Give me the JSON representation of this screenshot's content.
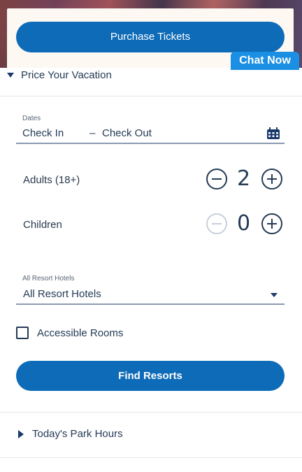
{
  "hero": {
    "purchase_label": "Purchase Tickets"
  },
  "chat": {
    "label": "Chat Now"
  },
  "price_section": {
    "title": "Price Your Vacation"
  },
  "dates": {
    "label": "Dates",
    "check_in": "Check In",
    "separator": "–",
    "check_out": "Check Out",
    "icon": "calendar-icon"
  },
  "guests": {
    "adults_label": "Adults (18+)",
    "adults_value": "2",
    "children_label": "Children",
    "children_value": "0"
  },
  "resort": {
    "label": "All Resort Hotels",
    "selected": "All Resort Hotels"
  },
  "accessible": {
    "label": "Accessible Rooms",
    "checked": false
  },
  "find_label": "Find Resorts",
  "park_hours": {
    "title": "Today's Park Hours"
  },
  "colors": {
    "primary": "#0e6bb8",
    "chat": "#1b8fe3",
    "text": "#253b56"
  }
}
